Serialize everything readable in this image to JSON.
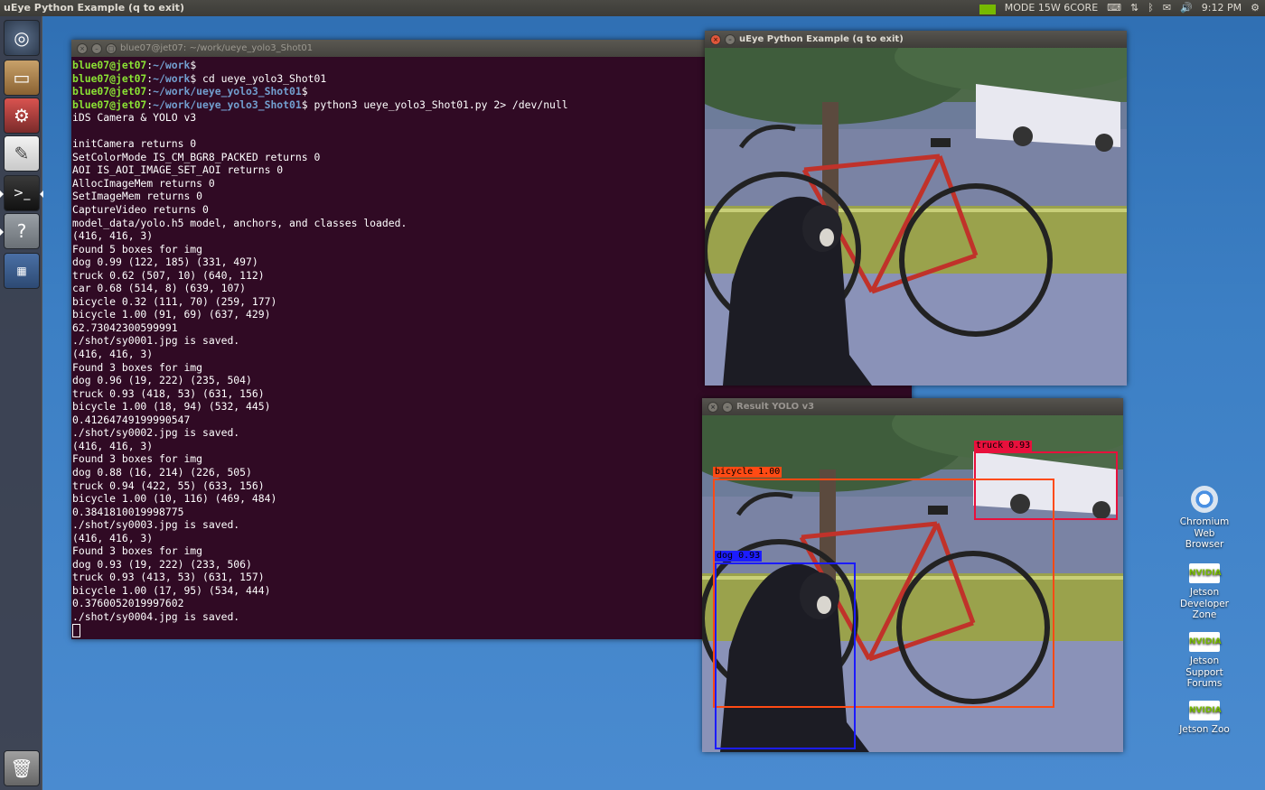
{
  "topbar": {
    "app_title": "uEye Python Example (q to exit)",
    "mode": "MODE 15W 6CORE",
    "time": "9:12 PM"
  },
  "terminal": {
    "title": "blue07@jet07: ~/work/ueye_yolo3_Shot01",
    "lines": [
      {
        "user": "blue07@jet07",
        "path": "~/work",
        "cmd": ""
      },
      {
        "user": "blue07@jet07",
        "path": "~/work",
        "cmd": " cd ueye_yolo3_Shot01"
      },
      {
        "user": "blue07@jet07",
        "path": "~/work/ueye_yolo3_Shot01",
        "cmd": ""
      },
      {
        "user": "blue07@jet07",
        "path": "~/work/ueye_yolo3_Shot01",
        "cmd": " python3 ueye_yolo3_Shot01.py 2> /dev/null"
      }
    ],
    "output": [
      "iDS Camera & YOLO v3",
      "",
      "initCamera returns 0",
      "SetColorMode IS_CM_BGR8_PACKED returns 0",
      "AOI IS_AOI_IMAGE_SET_AOI returns 0",
      "AllocImageMem returns 0",
      "SetImageMem returns 0",
      "CaptureVideo returns 0",
      "model_data/yolo.h5 model, anchors, and classes loaded.",
      "(416, 416, 3)",
      "Found 5 boxes for img",
      "dog 0.99 (122, 185) (331, 497)",
      "truck 0.62 (507, 10) (640, 112)",
      "car 0.68 (514, 8) (639, 107)",
      "bicycle 0.32 (111, 70) (259, 177)",
      "bicycle 1.00 (91, 69) (637, 429)",
      "62.73042300599991",
      "./shot/sy0001.jpg is saved.",
      "(416, 416, 3)",
      "Found 3 boxes for img",
      "dog 0.96 (19, 222) (235, 504)",
      "truck 0.93 (418, 53) (631, 156)",
      "bicycle 1.00 (18, 94) (532, 445)",
      "0.41264749199990547",
      "./shot/sy0002.jpg is saved.",
      "(416, 416, 3)",
      "Found 3 boxes for img",
      "dog 0.88 (16, 214) (226, 505)",
      "truck 0.94 (422, 55) (633, 156)",
      "bicycle 1.00 (10, 116) (469, 484)",
      "0.3841810019998775",
      "./shot/sy0003.jpg is saved.",
      "(416, 416, 3)",
      "Found 3 boxes for img",
      "dog 0.93 (19, 222) (233, 506)",
      "truck 0.93 (413, 53) (631, 157)",
      "bicycle 1.00 (17, 95) (534, 444)",
      "0.3760052019997602",
      "./shot/sy0004.jpg is saved."
    ]
  },
  "camera_window": {
    "title": "uEye Python Example (q to exit)"
  },
  "result_window": {
    "title": "Result YOLO v3",
    "detections": [
      {
        "label": "truck 0.93",
        "color": "#e8103c"
      },
      {
        "label": "bicycle 1.00",
        "color": "#ff4a14"
      },
      {
        "label": "dog 0.93",
        "color": "#1c1cff"
      }
    ]
  },
  "desktop_icons": [
    {
      "label": "Chromium Web Browser",
      "icon": "chromium-icon"
    },
    {
      "label": "Jetson Developer Zone",
      "icon": "nvidia-icon"
    },
    {
      "label": "Jetson Support Forums",
      "icon": "nvidia-icon"
    },
    {
      "label": "Jetson Zoo",
      "icon": "nvidia-icon"
    }
  ],
  "nvidia_text": "NVIDIA"
}
